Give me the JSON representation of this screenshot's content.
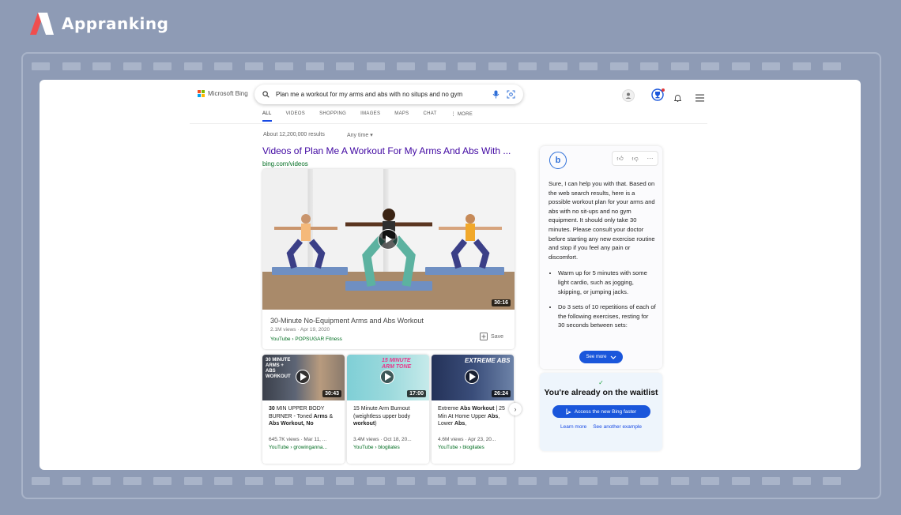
{
  "brand": {
    "name": "Appranking"
  },
  "bing": {
    "logo_text": "Microsoft Bing",
    "search_query": "Plan me a workout for my arms and abs with no situps and no gym",
    "tabs": [
      "ALL",
      "VIDEOS",
      "SHOPPING",
      "IMAGES",
      "MAPS",
      "CHAT",
      "MORE"
    ],
    "active_tab": "ALL",
    "results_count": "About 12,200,000 results",
    "time_filter": "Any time"
  },
  "videos": {
    "heading": "Videos of Plan Me A Workout For My Arms And Abs With ...",
    "url": "bing.com/videos",
    "main": {
      "duration": "30:16",
      "title": "30-Minute No-Equipment Arms and Abs Workout",
      "stats": "2.1M views · Apr 19, 2020",
      "source": "YouTube › POPSUGAR Fitness",
      "save_label": "Save"
    },
    "cards": [
      {
        "duration": "30:43",
        "thumb_text": "30 MINUTE ARMS + ABS WORKOUT",
        "title_parts": [
          [
            "30",
            true
          ],
          [
            " MIN UPPER BODY BURNER - Toned ",
            false
          ],
          [
            "Arms",
            true
          ],
          [
            " & ",
            false
          ],
          [
            "Abs Workout, No",
            true
          ]
        ],
        "stats": "645.7K views · Mar 11, ...",
        "source": "YouTube › growingannа..."
      },
      {
        "duration": "17:00",
        "thumb_text": "15 MINUTE ARM TONE",
        "title_parts": [
          [
            "15 Minute Arm Burnout (weightless upper body ",
            false
          ],
          [
            "workout",
            true
          ],
          [
            ")",
            false
          ]
        ],
        "stats": "3.4M views · Oct 18, 20...",
        "source": "YouTube › blogilates"
      },
      {
        "duration": "26:24",
        "thumb_text": "EXTREME ABS",
        "title_parts": [
          [
            "Extreme ",
            false
          ],
          [
            "Abs Workout",
            true
          ],
          [
            " | 25 Min At Home Upper ",
            false
          ],
          [
            "Abs",
            true
          ],
          [
            ", Lower ",
            false
          ],
          [
            "Abs",
            true
          ],
          [
            ",",
            false
          ]
        ],
        "stats": "4.6M views · Apr 23, 20...",
        "source": "YouTube › blogilates"
      }
    ]
  },
  "chat": {
    "intro": "Sure, I can help you with that. Based on the web search results, here is a possible workout plan for your arms and abs with no sit-ups and no gym equipment. It should only take 30 minutes. Please consult your doctor before starting any new exercise routine and stop if you feel any pain or discomfort.",
    "bullets": [
      "Warm up for 5 minutes with some light cardio, such as jogging, skipping, or jumping jacks.",
      "Do 3 sets of 10 repetitions of each of the following exercises, resting for 30 seconds between sets:"
    ],
    "see_more": "See more"
  },
  "waitlist": {
    "title": "You're already on the waitlist",
    "button": "Access the new Bing faster",
    "links": [
      "Learn more",
      "See another example"
    ]
  },
  "colors": {
    "background": "#8e9bb5",
    "bing_blue": "#1a56db",
    "title_purple": "#4007a2",
    "url_green": "#006d21"
  }
}
